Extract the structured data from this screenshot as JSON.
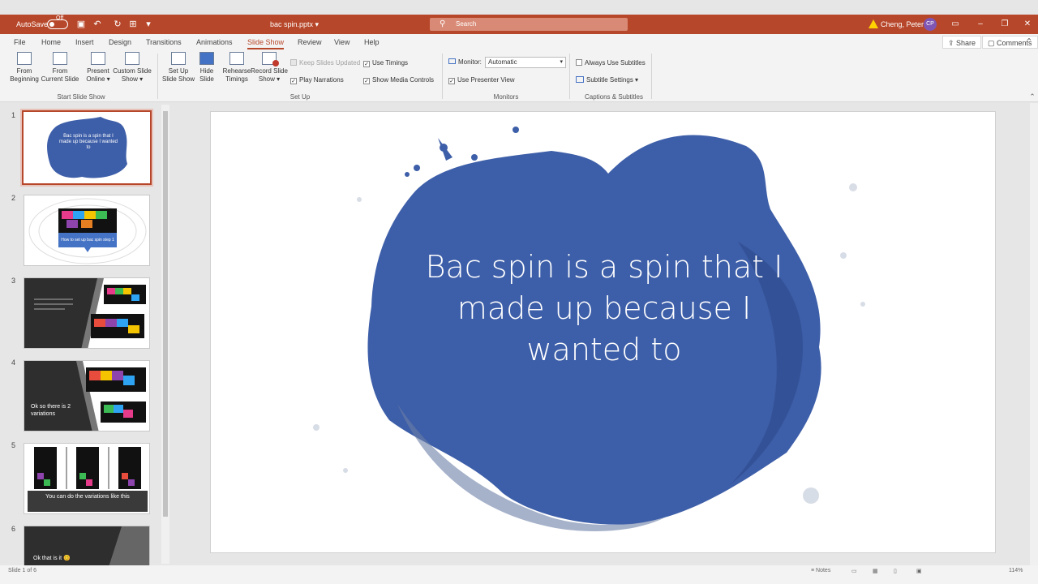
{
  "titlebar": {
    "autosave_label": "AutoSave",
    "autosave_state": "Off",
    "filename": "bac spin.pptx",
    "search_placeholder": "Search",
    "user_name": "Cheng, Peter",
    "user_initials": "CP",
    "accent_color": "#b7472a"
  },
  "tabs": [
    {
      "label": "File"
    },
    {
      "label": "Home"
    },
    {
      "label": "Insert"
    },
    {
      "label": "Design"
    },
    {
      "label": "Transitions"
    },
    {
      "label": "Animations"
    },
    {
      "label": "Slide Show"
    },
    {
      "label": "Review"
    },
    {
      "label": "View"
    },
    {
      "label": "Help"
    }
  ],
  "share_label": "Share",
  "comments_label": "Comments",
  "ribbon": {
    "from_beginning": [
      "From",
      "Beginning"
    ],
    "from_current": [
      "From",
      "Current Slide"
    ],
    "present_online": [
      "Present",
      "Online ▾"
    ],
    "custom_show": [
      "Custom Slide",
      "Show ▾"
    ],
    "group_start": "Start Slide Show",
    "set_up": [
      "Set Up",
      "Slide Show"
    ],
    "hide_slide": [
      "Hide",
      "Slide"
    ],
    "rehearse": [
      "Rehearse",
      "Timings"
    ],
    "record": [
      "Record Slide",
      "Show ▾"
    ],
    "keep_updated": "Keep Slides Updated",
    "play_narrations": "Play Narrations",
    "use_timings": "Use Timings",
    "show_media": "Show Media Controls",
    "group_setup": "Set Up",
    "monitor_label": "Monitor:",
    "monitor_value": "Automatic",
    "presenter_view": "Use Presenter View",
    "group_monitors": "Monitors",
    "always_subtitles": "Always Use Subtitles",
    "subtitle_settings": "Subtitle Settings ▾",
    "group_captions": "Captions & Subtitles"
  },
  "thumbnails": [
    {
      "num": "1",
      "text": "Bac spin is a spin that I made up because I wanted to"
    },
    {
      "num": "2",
      "text": "How to set up bac spin step 1"
    },
    {
      "num": "3",
      "text": ""
    },
    {
      "num": "4",
      "text": "Ok so there is 2 variations"
    },
    {
      "num": "5",
      "text": "You can do the variations like this"
    },
    {
      "num": "6",
      "text": "Ok that is it 😊"
    }
  ],
  "slide": {
    "title": "Bac spin is a spin that I made up because I wanted to",
    "blob_color": "#3d5ea8"
  },
  "status": {
    "slide_info": "Slide 1 of 6",
    "notes": "Notes",
    "zoom": "114%"
  }
}
